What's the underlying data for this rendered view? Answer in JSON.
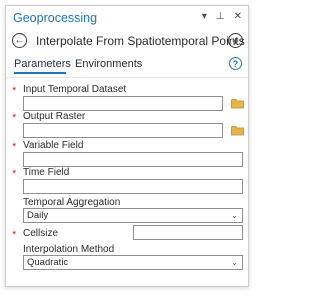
{
  "pane": {
    "title": "Geoprocessing",
    "controls": {
      "dropdown_glyph": "▾",
      "pin_glyph": "⊥",
      "close_glyph": "✕"
    }
  },
  "tool": {
    "title": "Interpolate From Spatiotemporal Points",
    "back_glyph": "←",
    "add_glyph": "+"
  },
  "tabs": {
    "parameters": "Parameters",
    "environments": "Environments",
    "help_glyph": "?"
  },
  "params": {
    "input_temporal_dataset": {
      "label": "Input Temporal Dataset",
      "required": true,
      "value": ""
    },
    "output_raster": {
      "label": "Output Raster",
      "required": true,
      "value": ""
    },
    "variable_field": {
      "label": "Variable Field",
      "required": true,
      "value": ""
    },
    "time_field": {
      "label": "Time Field",
      "required": true,
      "value": ""
    },
    "temporal_aggregation": {
      "label": "Temporal Aggregation",
      "value": "Daily"
    },
    "cellsize": {
      "label": "Cellsize",
      "required": true,
      "value": ""
    },
    "interpolation_method": {
      "label": "Interpolation Method",
      "value": "Quadratic"
    }
  },
  "required_glyph": "*",
  "chevron_glyph": "⌄",
  "colors": {
    "accent": "#1f76b9",
    "required": "#c63030",
    "folder": "#e8b44a"
  },
  "icons": {
    "back": "arrow-left-circle-icon",
    "add": "plus-circle-icon",
    "help": "question-circle-icon",
    "browse": "folder-icon"
  }
}
